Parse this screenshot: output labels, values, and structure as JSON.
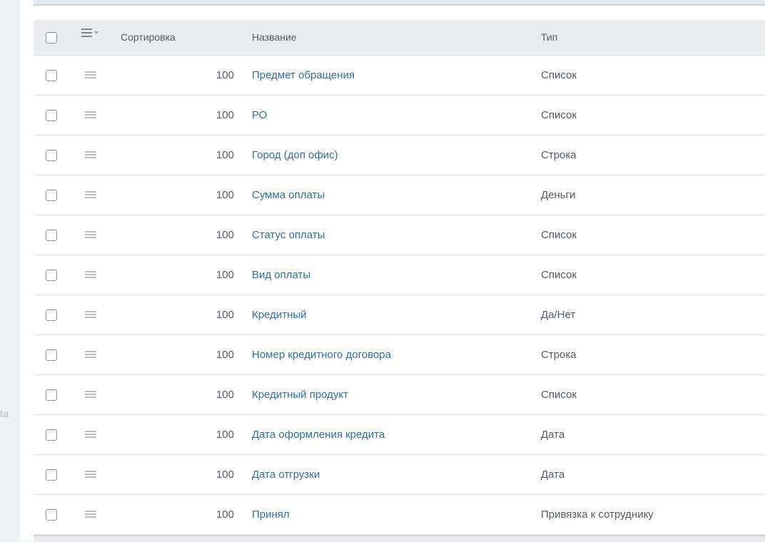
{
  "sidebar": {
    "partial_label": "ta"
  },
  "table": {
    "headers": {
      "sort": "Сортировка",
      "name": "Название",
      "type": "Тип"
    },
    "rows": [
      {
        "sort": "100",
        "name": "Предмет обращения",
        "type": "Список"
      },
      {
        "sort": "100",
        "name": "РО",
        "type": "Список"
      },
      {
        "sort": "100",
        "name": "Город (доп офис)",
        "type": "Строка"
      },
      {
        "sort": "100",
        "name": "Сумма оплаты",
        "type": "Деньги"
      },
      {
        "sort": "100",
        "name": "Статус оплаты",
        "type": "Список"
      },
      {
        "sort": "100",
        "name": "Вид оплаты",
        "type": "Список"
      },
      {
        "sort": "100",
        "name": "Кредитный",
        "type": "Да/Нет"
      },
      {
        "sort": "100",
        "name": "Номер кредитного договора",
        "type": "Строка"
      },
      {
        "sort": "100",
        "name": "Кредитный продукт",
        "type": "Список"
      },
      {
        "sort": "100",
        "name": "Дата оформления кредита",
        "type": "Дата"
      },
      {
        "sort": "100",
        "name": "Дата отгрузки",
        "type": "Дата"
      },
      {
        "sort": "100",
        "name": "Принял",
        "type": "Привязка к сотруднику"
      }
    ]
  },
  "colors": {
    "link": "#2f6ea7",
    "header_bg": "#e9edef",
    "page_bg": "#eef2f4"
  }
}
